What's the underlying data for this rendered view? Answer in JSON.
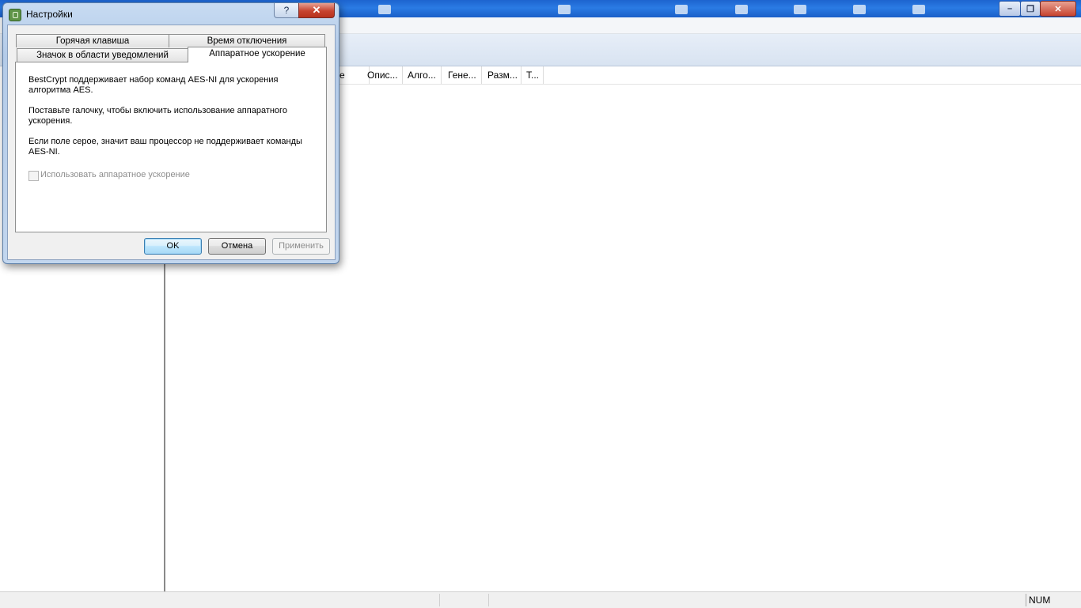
{
  "dialog": {
    "title": "Настройки",
    "help_glyph": "?",
    "close_glyph": "✕",
    "tabs": {
      "hotkey": "Горячая клавиша",
      "timeout": "Время отключения",
      "tray_icon": "Значок в области уведомлений",
      "hw_accel": "Аппаратное ускорение"
    },
    "panel": {
      "para1": "BestCrypt поддерживает набор команд AES-NI для ускорения алгоритма AES.",
      "para2": " Поставьте галочку, чтобы включить использование аппаратного ускорения.",
      "para3": "Если поле серое, значит ваш процессор не поддерживает команды AES-NI.",
      "checkbox_label": "Использовать аппаратное ускорение",
      "checkbox_checked": false,
      "checkbox_enabled": false
    },
    "buttons": {
      "ok": "OK",
      "cancel": "Отмена",
      "apply": "Применить"
    }
  },
  "main_window": {
    "list_columns": [
      "е",
      "Опис...",
      "Алго...",
      "Гене...",
      "Разм...",
      "Т..."
    ],
    "status_num": "NUM",
    "window_controls": {
      "minimize": "–",
      "restore": "❐",
      "close": "✕"
    }
  }
}
